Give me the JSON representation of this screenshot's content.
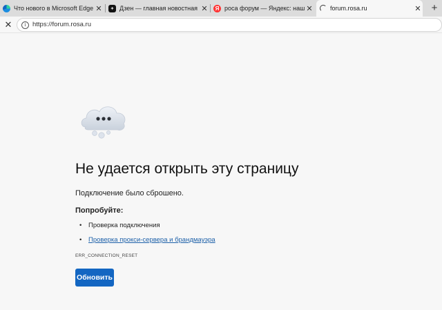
{
  "tabs": [
    {
      "title": "Что нового в Microsoft Edge",
      "icon": "edge-icon",
      "close": "✕"
    },
    {
      "title": "Дзен — главная новостная инфо",
      "icon": "dzen-icon",
      "close": "✕"
    },
    {
      "title": "роса форум — Яндекс: нашлось",
      "icon": "yandex-icon",
      "icon_text": "Я",
      "close": "✕"
    },
    {
      "title": "forum.rosa.ru",
      "icon": "loading-icon",
      "close": "✕",
      "active": true
    }
  ],
  "newtab_label": "+",
  "toolbar": {
    "stop_label": "✕",
    "info_glyph": "i",
    "url": "https://forum.rosa.ru"
  },
  "error": {
    "icon": "cloud-icon",
    "heading": "Не удается открыть эту страницу",
    "subtitle": "Подключение было сброшено.",
    "try_title": "Попробуйте:",
    "suggestions": [
      {
        "bullet": "•",
        "text": "Проверка подключения"
      },
      {
        "bullet": "•",
        "text": "Проверка прокси-сервера и брандмауэра"
      }
    ],
    "code": "ERR_CONNECTION_RESET",
    "reload_label": "Обновить"
  },
  "colors": {
    "accent": "#1366c2",
    "link": "#1b5fa8",
    "tabstrip": "#dcdcdc",
    "page_bg": "#f7f7f7"
  }
}
